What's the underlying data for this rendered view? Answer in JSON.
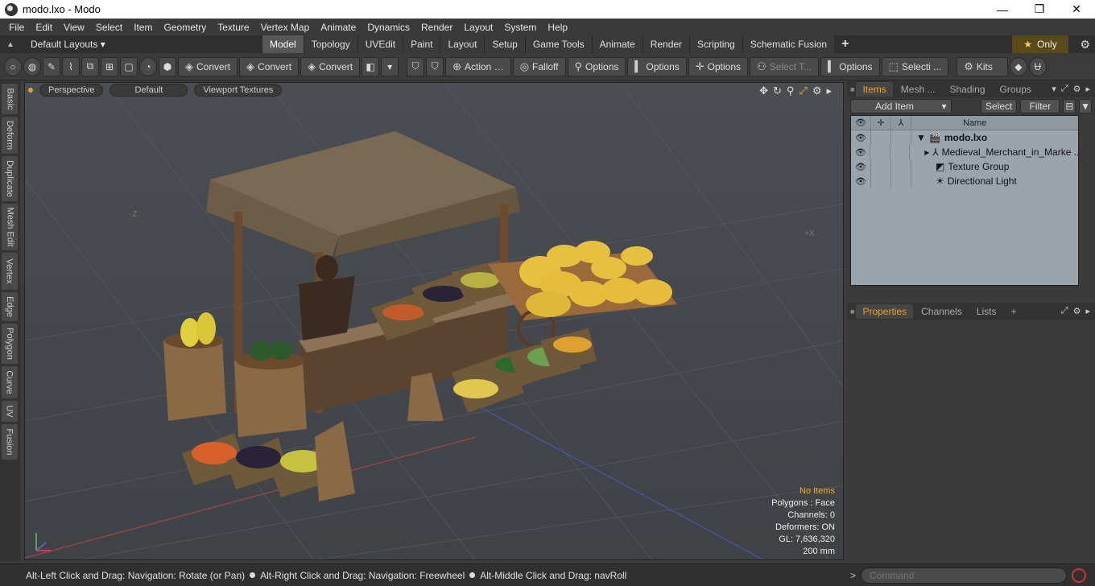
{
  "window": {
    "title": "modo.lxo - Modo",
    "min": "—",
    "max": "❐",
    "close": "✕"
  },
  "menu": [
    "File",
    "Edit",
    "View",
    "Select",
    "Item",
    "Geometry",
    "Texture",
    "Vertex Map",
    "Animate",
    "Dynamics",
    "Render",
    "Layout",
    "System",
    "Help"
  ],
  "layoutbar": {
    "layouts_label": "Default Layouts ▾",
    "tabs": [
      "Model",
      "Topology",
      "UVEdit",
      "Paint",
      "Layout",
      "Setup",
      "Game Tools",
      "Animate",
      "Render",
      "Scripting",
      "Schematic Fusion"
    ],
    "active_tab": "Model",
    "plus": "+",
    "only_label": "Only",
    "star": "★"
  },
  "toolbar": {
    "convert1": "Convert",
    "convert2": "Convert",
    "convert3": "Convert",
    "action": "Action",
    "falloff": "Falloff",
    "options1": "Options",
    "options2": "Options",
    "options3": "Options",
    "select_t": "Select T...",
    "options4": "Options",
    "selecti": "Selecti ...",
    "kits": "Kits"
  },
  "left_tabs": [
    "Basic",
    "Deform",
    "Duplicate",
    "Mesh Edit",
    "Vertex",
    "Edge",
    "Polygon",
    "Curve",
    "UV",
    "Fusion"
  ],
  "viewport": {
    "view": "Perspective",
    "style": "Default",
    "textures": "Viewport Textures",
    "label_z": "-Z",
    "label_x": "+X",
    "stats": {
      "items": "No Items",
      "polygons": "Polygons : Face",
      "channels": "Channels: 0",
      "deformers": "Deformers: ON",
      "gl": "GL: 7,636,320",
      "scale": "200 mm"
    }
  },
  "items_panel": {
    "tabs": [
      "Items",
      "Mesh ...",
      "Shading",
      "Groups"
    ],
    "add_item": "Add Item",
    "select": "Select",
    "filter": "Filter",
    "col_name": "Name",
    "tree": [
      {
        "name": "modo.lxo",
        "root": true
      },
      {
        "name": "Medieval_Merchant_in_Marke ..."
      },
      {
        "name": "Texture Group"
      },
      {
        "name": "Directional Light"
      }
    ]
  },
  "props_panel": {
    "tabs": [
      "Properties",
      "Channels",
      "Lists"
    ],
    "plus": "+"
  },
  "status": {
    "hint1": "Alt-Left Click and Drag: Navigation: Rotate (or Pan)",
    "hint2": "Alt-Right Click and Drag: Navigation: Freewheel",
    "hint3": "Alt-Middle Click and Drag: navRoll",
    "command_placeholder": "Command",
    "prompt": ">"
  },
  "colors": {
    "accent": "#f0a020",
    "viewport_bg": "#45494d"
  }
}
